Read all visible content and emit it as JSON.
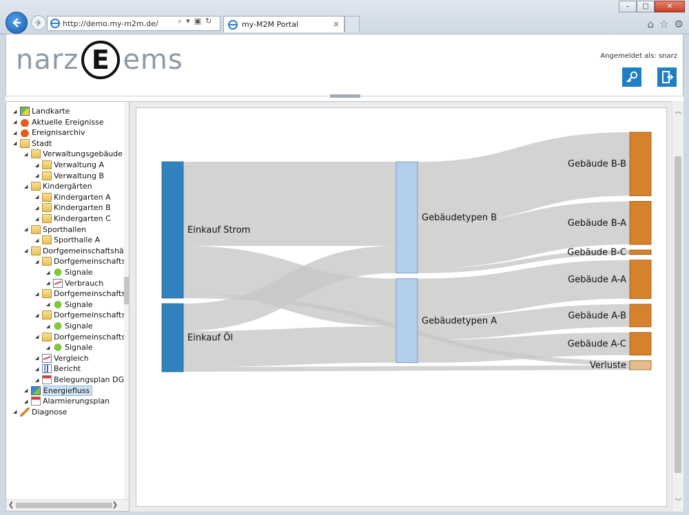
{
  "browser": {
    "url": "http://demo.my-m2m.de/",
    "tab_title": "my-M2M Portal",
    "tab_close": "×",
    "win_min": "–",
    "win_max": "□",
    "win_close": "✕"
  },
  "header": {
    "logo_left": "narz",
    "logo_center": "E",
    "logo_right": "ems",
    "logged_in": "Angemeldet als: snarz"
  },
  "tree": [
    {
      "label": "Landkarte",
      "level": 0,
      "icon": "map-icon",
      "arrow": "◢"
    },
    {
      "label": "Aktuelle Ereignisse",
      "level": 0,
      "icon": "alarm-icon",
      "arrow": "◢"
    },
    {
      "label": "Ereignisarchiv",
      "level": 0,
      "icon": "alarm-icon",
      "arrow": "◢"
    },
    {
      "label": "Stadt",
      "level": 0,
      "icon": "folder-icon",
      "arrow": "◢"
    },
    {
      "label": "Verwaltungsgebäude",
      "level": 1,
      "icon": "folder-icon",
      "arrow": "◢"
    },
    {
      "label": "Verwaltung A",
      "level": 2,
      "icon": "folder-icon",
      "arrow": "◢"
    },
    {
      "label": "Verwaltung B",
      "level": 2,
      "icon": "folder-icon",
      "arrow": "◢"
    },
    {
      "label": "Kindergärten",
      "level": 1,
      "icon": "folder-icon",
      "arrow": "◢"
    },
    {
      "label": "Kindergarten A",
      "level": 2,
      "icon": "folder-icon",
      "arrow": "◢"
    },
    {
      "label": "Kindergarten B",
      "level": 2,
      "icon": "folder-icon",
      "arrow": "◢"
    },
    {
      "label": "Kindergarten C",
      "level": 2,
      "icon": "folder-icon",
      "arrow": "◢"
    },
    {
      "label": "Sporthallen",
      "level": 1,
      "icon": "folder-icon",
      "arrow": "◢"
    },
    {
      "label": "Sporthalle A",
      "level": 2,
      "icon": "folder-icon",
      "arrow": "◢"
    },
    {
      "label": "Dorfgemeinschaftshäu",
      "level": 1,
      "icon": "folder-icon",
      "arrow": "◢"
    },
    {
      "label": "Dorfgemeinschafts",
      "level": 2,
      "icon": "folder-icon",
      "arrow": "◢"
    },
    {
      "label": "Signale",
      "level": 3,
      "icon": "signal-icon",
      "arrow": "◢"
    },
    {
      "label": "Verbrauch",
      "level": 3,
      "icon": "chart-icon",
      "arrow": "◢"
    },
    {
      "label": "Dorfgemeinschafts",
      "level": 2,
      "icon": "folder-icon",
      "arrow": "◢"
    },
    {
      "label": "Signale",
      "level": 3,
      "icon": "signal-icon",
      "arrow": "◢"
    },
    {
      "label": "Dorfgemeinschafts",
      "level": 2,
      "icon": "folder-icon",
      "arrow": "◢"
    },
    {
      "label": "Signale",
      "level": 3,
      "icon": "signal-icon",
      "arrow": "◢"
    },
    {
      "label": "Dorfgemeinschafts",
      "level": 2,
      "icon": "folder-icon",
      "arrow": "◢"
    },
    {
      "label": "Signale",
      "level": 3,
      "icon": "signal-icon",
      "arrow": "◢"
    },
    {
      "label": "Vergleich",
      "level": 2,
      "icon": "chart-icon",
      "arrow": "◢"
    },
    {
      "label": "Bericht",
      "level": 2,
      "icon": "bar-icon",
      "arrow": "◢"
    },
    {
      "label": "Belegungsplan DGH",
      "level": 2,
      "icon": "calendar-icon",
      "arrow": "◢"
    },
    {
      "label": "Energiefluss",
      "level": 1,
      "icon": "flow-icon",
      "arrow": "◢",
      "selected": true
    },
    {
      "label": "Alarmierungsplan",
      "level": 1,
      "icon": "calendar-icon",
      "arrow": "◢"
    },
    {
      "label": "Diagnose",
      "level": 0,
      "icon": "diagnose-icon",
      "arrow": "◢"
    }
  ],
  "chart_data": {
    "type": "sankey",
    "colors": {
      "source": "#3282be",
      "middle": "#b3cdec",
      "target": "#d6822c",
      "loss": "#e6bc8c",
      "link": "#c8c8c8"
    },
    "nodes": [
      {
        "id": "strom",
        "label": "Einkauf Strom",
        "column": 0,
        "value": 60
      },
      {
        "id": "oel",
        "label": "Einkauf Öl",
        "column": 0,
        "value": 30
      },
      {
        "id": "typB",
        "label": "Gebäudetypen B",
        "column": 1,
        "value": 49
      },
      {
        "id": "typA",
        "label": "Gebäudetypen A",
        "column": 1,
        "value": 37
      },
      {
        "id": "bb",
        "label": "Gebäude B-B",
        "column": 2,
        "value": 28
      },
      {
        "id": "ba",
        "label": "Gebäude B-A",
        "column": 2,
        "value": 19
      },
      {
        "id": "bc",
        "label": "Gebäude B-C",
        "column": 2,
        "value": 2
      },
      {
        "id": "aa",
        "label": "Gebäude A-A",
        "column": 2,
        "value": 17
      },
      {
        "id": "ab",
        "label": "Gebäude A-B",
        "column": 2,
        "value": 10
      },
      {
        "id": "ac",
        "label": "Gebäude A-C",
        "column": 2,
        "value": 10
      },
      {
        "id": "verluste",
        "label": "Verluste",
        "column": 2,
        "value": 4
      }
    ],
    "links": [
      {
        "source": "strom",
        "target": "typB",
        "value": 37
      },
      {
        "source": "strom",
        "target": "typA",
        "value": 21
      },
      {
        "source": "strom",
        "target": "verluste",
        "value": 2
      },
      {
        "source": "oel",
        "target": "typB",
        "value": 12
      },
      {
        "source": "oel",
        "target": "typA",
        "value": 16
      },
      {
        "source": "oel",
        "target": "verluste",
        "value": 2
      },
      {
        "source": "typB",
        "target": "bb",
        "value": 28
      },
      {
        "source": "typB",
        "target": "ba",
        "value": 19
      },
      {
        "source": "typB",
        "target": "bc",
        "value": 2
      },
      {
        "source": "typA",
        "target": "aa",
        "value": 17
      },
      {
        "source": "typA",
        "target": "ab",
        "value": 10
      },
      {
        "source": "typA",
        "target": "ac",
        "value": 10
      }
    ]
  }
}
